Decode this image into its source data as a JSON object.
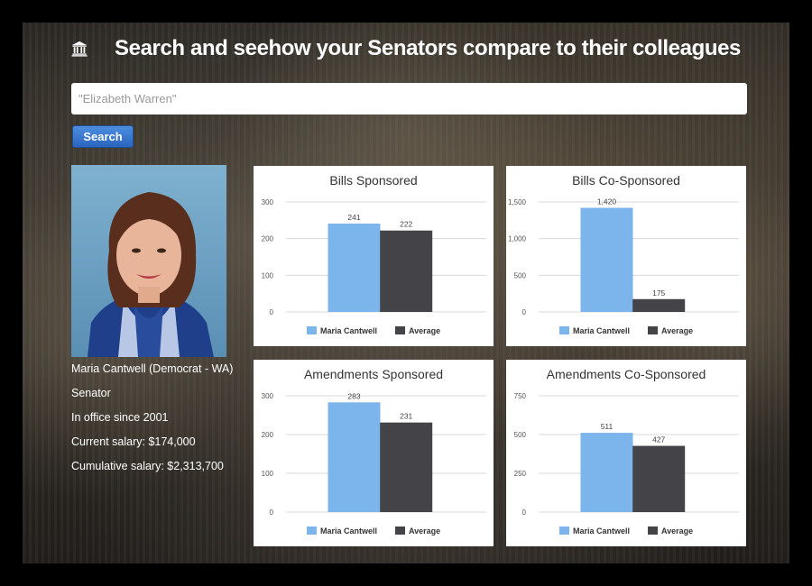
{
  "header": {
    "title": "Search and seehow your Senators compare to their colleagues",
    "logo_icon": "capitol-building-icon"
  },
  "search": {
    "placeholder": "\"Elizabeth Warren\"",
    "value": "",
    "button_label": "Search"
  },
  "senator": {
    "name_line": "Maria Cantwell (Democrat - WA)",
    "position": "Senator",
    "in_office": "In office since 2001",
    "current_salary": "Current salary: $174,000",
    "cumulative_salary": "Cumulative salary: $2,313,700"
  },
  "colors": {
    "senator": "#7cb5ec",
    "average": "#434348",
    "button": "#2a65bf"
  },
  "chart_data": [
    {
      "type": "bar",
      "title": "Bills Sponsored",
      "series": [
        {
          "name": "Maria Cantwell",
          "values": [
            241
          ]
        },
        {
          "name": "Average",
          "values": [
            222
          ]
        }
      ],
      "ylim": [
        0,
        300
      ],
      "yticks": [
        0,
        100,
        200,
        300
      ],
      "data_labels": [
        "241",
        "222"
      ],
      "legend": "bottom",
      "grid": true
    },
    {
      "type": "bar",
      "title": "Bills Co-Sponsored",
      "series": [
        {
          "name": "Maria Cantwell",
          "values": [
            1420
          ]
        },
        {
          "name": "Average",
          "values": [
            175
          ]
        }
      ],
      "ylim": [
        0,
        1500
      ],
      "yticks": [
        0,
        500,
        1000,
        1500
      ],
      "data_labels": [
        "1,420",
        "175"
      ],
      "legend": "bottom",
      "grid": true
    },
    {
      "type": "bar",
      "title": "Amendments Sponsored",
      "series": [
        {
          "name": "Maria Cantwell",
          "values": [
            283
          ]
        },
        {
          "name": "Average",
          "values": [
            231
          ]
        }
      ],
      "ylim": [
        0,
        300
      ],
      "yticks": [
        0,
        100,
        200,
        300
      ],
      "data_labels": [
        "283",
        "231"
      ],
      "legend": "bottom",
      "grid": true
    },
    {
      "type": "bar",
      "title": "Amendments Co-Sponsored",
      "series": [
        {
          "name": "Maria Cantwell",
          "values": [
            511
          ]
        },
        {
          "name": "Average",
          "values": [
            427
          ]
        }
      ],
      "ylim": [
        0,
        750
      ],
      "yticks": [
        0,
        250,
        500,
        750
      ],
      "data_labels": [
        "511",
        "427"
      ],
      "legend": "bottom",
      "grid": true
    }
  ]
}
